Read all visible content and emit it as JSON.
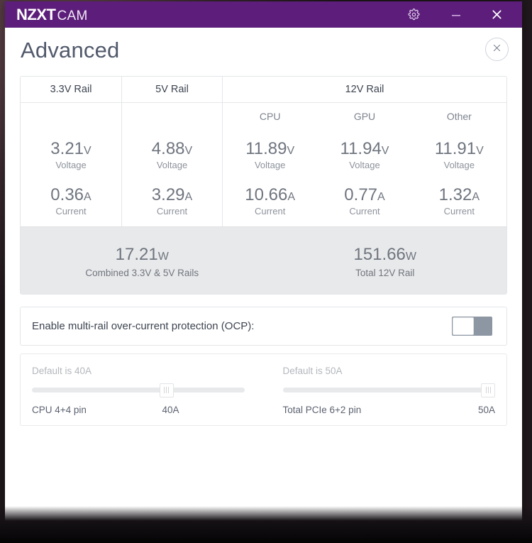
{
  "titlebar": {
    "brand_bold": "NZXT",
    "brand_light": "CAM",
    "settings_icon": "gear-icon",
    "minimize_icon": "minimize-icon",
    "close_icon": "close-icon",
    "background_color": "#5c1e7a"
  },
  "header": {
    "title": "Advanced",
    "close_icon": "close-icon"
  },
  "rails": {
    "columns": [
      {
        "label": "3.3V Rail"
      },
      {
        "label": "5V Rail"
      },
      {
        "label": "12V Rail"
      }
    ],
    "subcolumns": [
      "CPU",
      "GPU",
      "Other"
    ],
    "voltage_label": "Voltage",
    "current_label": "Current",
    "cells": [
      {
        "name": "3.3V Rail",
        "voltage": "3.21",
        "voltage_unit": "V",
        "current": "0.36",
        "current_unit": "A"
      },
      {
        "name": "5V Rail",
        "voltage": "4.88",
        "voltage_unit": "V",
        "current": "3.29",
        "current_unit": "A"
      },
      {
        "name": "CPU",
        "voltage": "11.89",
        "voltage_unit": "V",
        "current": "10.66",
        "current_unit": "A"
      },
      {
        "name": "GPU",
        "voltage": "11.94",
        "voltage_unit": "V",
        "current": "0.77",
        "current_unit": "A"
      },
      {
        "name": "Other",
        "voltage": "11.91",
        "voltage_unit": "V",
        "current": "1.32",
        "current_unit": "A"
      }
    ]
  },
  "totals": {
    "background_color": "#e8e9ea",
    "items": [
      {
        "value": "17.21",
        "unit": "W",
        "label": "Combined 3.3V & 5V Rails"
      },
      {
        "value": "151.66",
        "unit": "W",
        "label": "Total 12V Rail"
      }
    ]
  },
  "ocp": {
    "label": "Enable multi-rail over-current protection (OCP):",
    "toggle_state": "off"
  },
  "sliders": [
    {
      "default_text": "Default is 40A",
      "name": "CPU 4+4 pin",
      "value_text": "40A",
      "value": 40,
      "fill_percent": 60
    },
    {
      "default_text": "Default is 50A",
      "name": "Total PCIe 6+2 pin",
      "value_text": "50A",
      "value": 50,
      "fill_percent": 100
    }
  ]
}
